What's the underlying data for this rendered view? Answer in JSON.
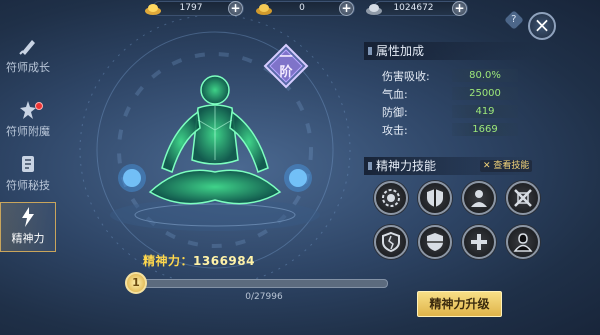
{
  "currencies": [
    {
      "name": "gold-ingot",
      "value": "1797"
    },
    {
      "name": "silver-ingot",
      "value": "0"
    },
    {
      "name": "silver-coin",
      "value": "1024672"
    }
  ],
  "help_label": "?",
  "close_label": "×",
  "tabs": [
    {
      "label": "符师成长",
      "active": false
    },
    {
      "label": "符师附魔",
      "active": false,
      "badge": true
    },
    {
      "label": "符师秘技",
      "active": false
    },
    {
      "label": "精神力",
      "active": true
    }
  ],
  "rank": {
    "line1": "一",
    "line2": "阶"
  },
  "power": {
    "label": "精神力：",
    "value": "1366984"
  },
  "progress": {
    "level": "1",
    "current": 0,
    "max": 27996,
    "text": "0/27996"
  },
  "attributes": {
    "title": "属性加成",
    "items": [
      {
        "label": "伤害吸收:",
        "value": "80.0%"
      },
      {
        "label": "气血:",
        "value": "25000"
      },
      {
        "label": "防御:",
        "value": "419"
      },
      {
        "label": "攻击:",
        "value": "1669"
      }
    ]
  },
  "skills": {
    "title": "精神力技能",
    "view_label": "查看技能",
    "icons": [
      "gear-shield-icon",
      "split-shield-icon",
      "warrior-bust-icon",
      "crossed-swords-icon",
      "cracked-shield-icon",
      "checker-shield-icon",
      "cross-shield-icon",
      "dark-figure-icon"
    ]
  },
  "upgrade_label": "精神力升级",
  "colors": {
    "accent_gold": "#ffd84d",
    "stat_green": "#9de87a",
    "aura_green": "#3fe08a"
  }
}
